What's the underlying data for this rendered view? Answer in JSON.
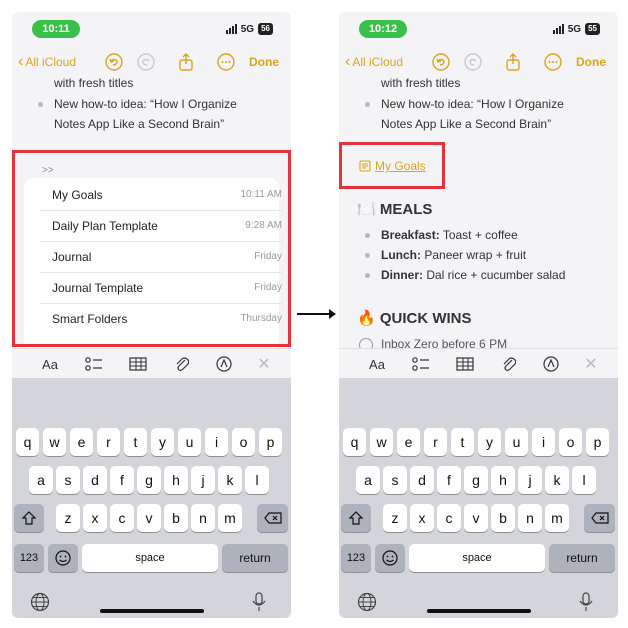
{
  "left": {
    "status": {
      "time": "10:11",
      "network": "5G",
      "battery": "56"
    },
    "nav": {
      "back_label": "All iCloud",
      "done_label": "Done"
    },
    "note_lines": [
      "with fresh titles",
      "New how-to idea: “How I Organize",
      "Notes App Like a Second Brain”"
    ],
    "link_prefix": ">>",
    "suggestions": [
      {
        "title": "My Goals",
        "date": "10:11 AM"
      },
      {
        "title": "Daily Plan Template",
        "date": "9:28 AM"
      },
      {
        "title": "Journal",
        "date": "Friday"
      },
      {
        "title": "Journal Template",
        "date": "Friday"
      },
      {
        "title": "Smart Folders",
        "date": "Thursday"
      }
    ]
  },
  "right": {
    "status": {
      "time": "10:12",
      "network": "5G",
      "battery": "55"
    },
    "nav": {
      "back_label": "All iCloud",
      "done_label": "Done"
    },
    "note_lines": [
      "with fresh titles",
      "New how-to idea: “How I Organize",
      "Notes App Like a Second Brain”"
    ],
    "linked_note": "My Goals",
    "meals_heading": "MEALS",
    "meals_emoji": "🍽️",
    "meals": [
      {
        "label": "Breakfast:",
        "value": "Toast + coffee"
      },
      {
        "label": "Lunch:",
        "value": "Paneer wrap + fruit"
      },
      {
        "label": "Dinner:",
        "value": "Dal rice + cucumber salad"
      }
    ],
    "wins_heading": "QUICK WINS",
    "wins_emoji": "🔥",
    "first_win": "Inbox Zero before 6 PM"
  },
  "toolbar": {
    "format_label": "Aa"
  },
  "keyboard": {
    "row1": [
      "q",
      "w",
      "e",
      "r",
      "t",
      "y",
      "u",
      "i",
      "o",
      "p"
    ],
    "row2": [
      "a",
      "s",
      "d",
      "f",
      "g",
      "h",
      "j",
      "k",
      "l"
    ],
    "row3": [
      "z",
      "x",
      "c",
      "v",
      "b",
      "n",
      "m"
    ],
    "numbers_label": "123",
    "space_label": "space",
    "return_label": "return"
  },
  "colors": {
    "accent": "#d7a41e",
    "highlight": "#e2343a",
    "status_pill": "#39c04a"
  }
}
